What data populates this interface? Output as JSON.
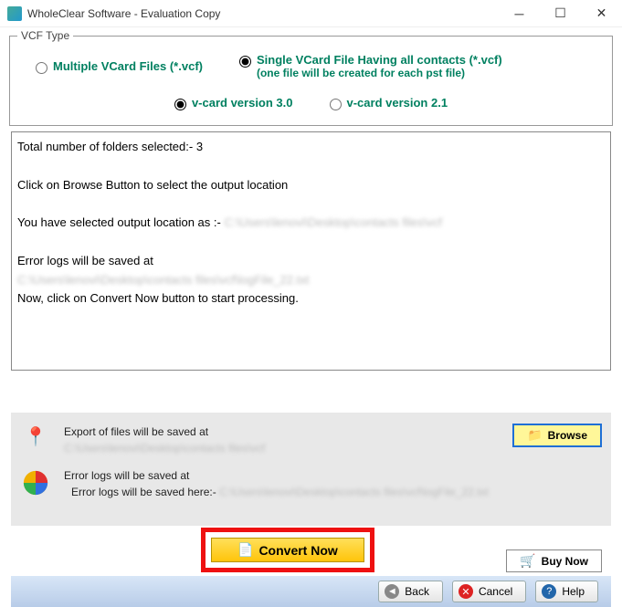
{
  "titlebar": {
    "text": "WholeClear Software - Evaluation Copy"
  },
  "vcf": {
    "legend": "VCF Type",
    "opt_multiple": "Multiple VCard Files (*.vcf)",
    "opt_single_line1": "Single VCard File Having all contacts (*.vcf)",
    "opt_single_line2": "(one file will be created for each pst file)",
    "ver30": "v-card version 3.0",
    "ver21": "v-card version 2.1"
  },
  "log": {
    "l1": "Total number of folders selected:- 3",
    "l2": "Click on Browse Button to select the output location",
    "l3a": "You have selected output location as :- ",
    "l3b": "C:\\Users\\lenovi\\Desktop\\contacts files\\vcf",
    "l4": "Error logs will be saved at",
    "l5": "C:\\Users\\lenovi\\Desktop\\contacts files\\vcf\\logFile_22.txt",
    "l6": "Now, click on Convert Now button to start processing."
  },
  "export": {
    "heading": "Export of files will be saved at",
    "path": "C:\\Users\\lenovi\\Desktop\\contacts files\\vcf",
    "browse": "Browse"
  },
  "error": {
    "heading": "Error logs will be saved at",
    "prefix": "Error logs will be saved here:- ",
    "path": "C:\\Users\\lenovi\\Desktop\\contacts files\\vcf\\logFile_22.txt"
  },
  "buttons": {
    "convert": "Convert Now",
    "buy": "Buy Now",
    "back": "Back",
    "cancel": "Cancel",
    "help": "Help"
  }
}
